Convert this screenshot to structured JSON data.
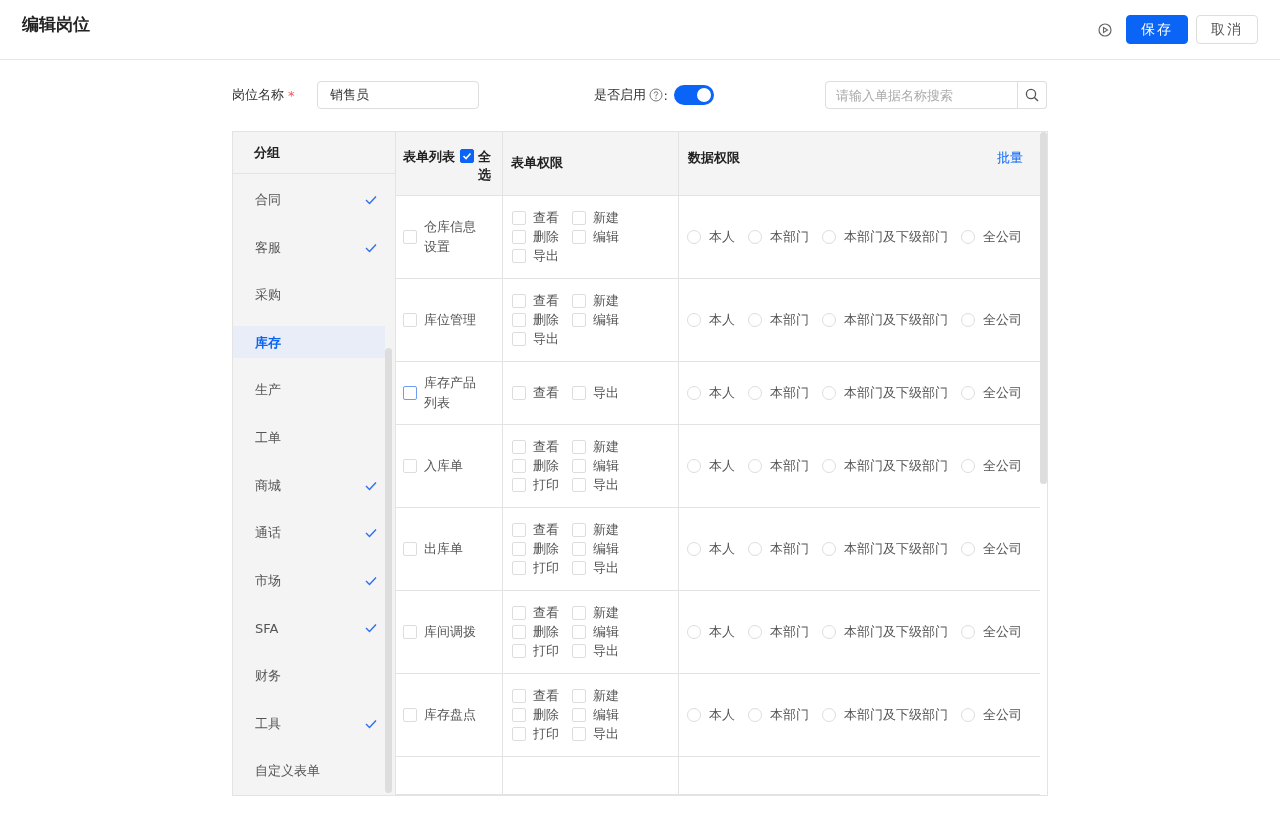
{
  "header": {
    "title": "编辑岗位",
    "buttons": [
      {
        "label": "保存",
        "kind": "primary"
      },
      {
        "label": "取消",
        "kind": "default"
      }
    ]
  },
  "form": {
    "name_label": "岗位名称",
    "required_mark": "*",
    "name_value": "销售员",
    "enable_label": "是否启用",
    "enable_suffix": ":",
    "enabled": true,
    "search_placeholder": "请输入单据名称搜索"
  },
  "groups": {
    "title": "分组",
    "items": [
      {
        "label": "合同",
        "checked": true,
        "selected": false
      },
      {
        "label": "客服",
        "checked": true,
        "selected": false
      },
      {
        "label": "采购",
        "checked": false,
        "selected": false
      },
      {
        "label": "库存",
        "checked": false,
        "selected": true
      },
      {
        "label": "生产",
        "checked": false,
        "selected": false
      },
      {
        "label": "工单",
        "checked": false,
        "selected": false
      },
      {
        "label": "商城",
        "checked": true,
        "selected": false
      },
      {
        "label": "通话",
        "checked": true,
        "selected": false
      },
      {
        "label": "市场",
        "checked": true,
        "selected": false
      },
      {
        "label": "SFA",
        "checked": true,
        "selected": false
      },
      {
        "label": "财务",
        "checked": false,
        "selected": false
      },
      {
        "label": "工具",
        "checked": true,
        "selected": false
      },
      {
        "label": "自定义表单",
        "checked": false,
        "selected": false
      }
    ]
  },
  "table": {
    "columns": {
      "list": "表单列表",
      "select_all": "全选",
      "select_all_checked": true,
      "perms": "表单权限",
      "data": "数据权限",
      "batch": "批量"
    },
    "rows": [
      {
        "name": "仓库信息设置",
        "checked": false,
        "focused": false,
        "perms": [
          {
            "label": "查看",
            "checked": false
          },
          {
            "label": "新建",
            "checked": false
          },
          {
            "label": "删除",
            "checked": false
          },
          {
            "label": "编辑",
            "checked": false
          },
          {
            "label": "导出",
            "checked": false
          }
        ],
        "scopes": [
          {
            "label": "本人",
            "selected": false
          },
          {
            "label": "本部门",
            "selected": false
          },
          {
            "label": "本部门及下级部门",
            "selected": false
          },
          {
            "label": "全公司",
            "selected": false
          }
        ]
      },
      {
        "name": "库位管理",
        "checked": false,
        "focused": false,
        "perms": [
          {
            "label": "查看",
            "checked": false
          },
          {
            "label": "新建",
            "checked": false
          },
          {
            "label": "删除",
            "checked": false
          },
          {
            "label": "编辑",
            "checked": false
          },
          {
            "label": "导出",
            "checked": false
          }
        ],
        "scopes": [
          {
            "label": "本人",
            "selected": false
          },
          {
            "label": "本部门",
            "selected": false
          },
          {
            "label": "本部门及下级部门",
            "selected": false
          },
          {
            "label": "全公司",
            "selected": false
          }
        ]
      },
      {
        "name": "库存产品列表",
        "checked": false,
        "focused": true,
        "perms": [
          {
            "label": "查看",
            "checked": false
          },
          {
            "label": "导出",
            "checked": false
          }
        ],
        "scopes": [
          {
            "label": "本人",
            "selected": false
          },
          {
            "label": "本部门",
            "selected": false
          },
          {
            "label": "本部门及下级部门",
            "selected": false
          },
          {
            "label": "全公司",
            "selected": false
          }
        ]
      },
      {
        "name": "入库单",
        "checked": false,
        "focused": false,
        "perms": [
          {
            "label": "查看",
            "checked": false
          },
          {
            "label": "新建",
            "checked": false
          },
          {
            "label": "删除",
            "checked": false
          },
          {
            "label": "编辑",
            "checked": false
          },
          {
            "label": "打印",
            "checked": false
          },
          {
            "label": "导出",
            "checked": false
          }
        ],
        "scopes": [
          {
            "label": "本人",
            "selected": false
          },
          {
            "label": "本部门",
            "selected": false
          },
          {
            "label": "本部门及下级部门",
            "selected": false
          },
          {
            "label": "全公司",
            "selected": false
          }
        ]
      },
      {
        "name": "出库单",
        "checked": false,
        "focused": false,
        "perms": [
          {
            "label": "查看",
            "checked": false
          },
          {
            "label": "新建",
            "checked": false
          },
          {
            "label": "删除",
            "checked": false
          },
          {
            "label": "编辑",
            "checked": false
          },
          {
            "label": "打印",
            "checked": false
          },
          {
            "label": "导出",
            "checked": false
          }
        ],
        "scopes": [
          {
            "label": "本人",
            "selected": false
          },
          {
            "label": "本部门",
            "selected": false
          },
          {
            "label": "本部门及下级部门",
            "selected": false
          },
          {
            "label": "全公司",
            "selected": false
          }
        ]
      },
      {
        "name": "库间调拨",
        "checked": false,
        "focused": false,
        "perms": [
          {
            "label": "查看",
            "checked": false
          },
          {
            "label": "新建",
            "checked": false
          },
          {
            "label": "删除",
            "checked": false
          },
          {
            "label": "编辑",
            "checked": false
          },
          {
            "label": "打印",
            "checked": false
          },
          {
            "label": "导出",
            "checked": false
          }
        ],
        "scopes": [
          {
            "label": "本人",
            "selected": false
          },
          {
            "label": "本部门",
            "selected": false
          },
          {
            "label": "本部门及下级部门",
            "selected": false
          },
          {
            "label": "全公司",
            "selected": false
          }
        ]
      },
      {
        "name": "库存盘点",
        "checked": false,
        "focused": false,
        "perms": [
          {
            "label": "查看",
            "checked": false
          },
          {
            "label": "新建",
            "checked": false
          },
          {
            "label": "删除",
            "checked": false
          },
          {
            "label": "编辑",
            "checked": false
          },
          {
            "label": "打印",
            "checked": false
          },
          {
            "label": "导出",
            "checked": false
          }
        ],
        "scopes": [
          {
            "label": "本人",
            "selected": false
          },
          {
            "label": "本部门",
            "selected": false
          },
          {
            "label": "本部门及下级部门",
            "selected": false
          },
          {
            "label": "全公司",
            "selected": false
          }
        ]
      }
    ]
  }
}
